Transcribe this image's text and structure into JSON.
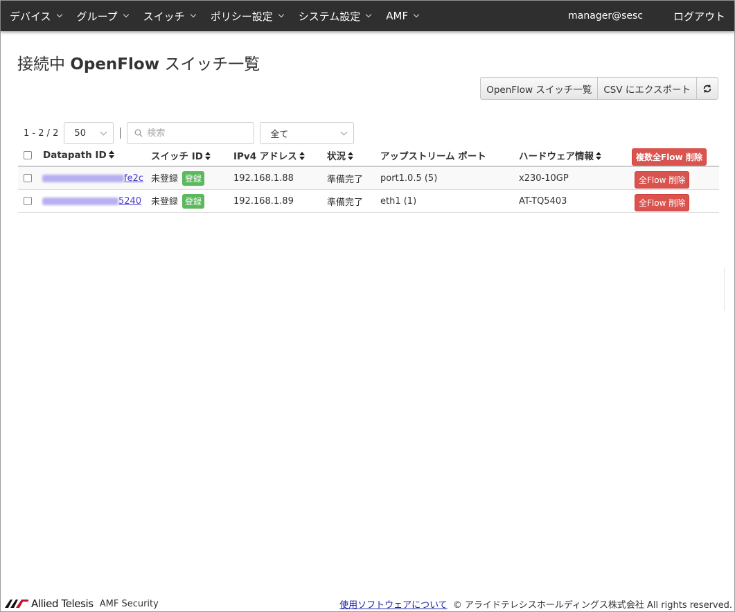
{
  "nav": {
    "items": [
      {
        "label": "デバイス"
      },
      {
        "label": "グループ"
      },
      {
        "label": "スイッチ"
      },
      {
        "label": "ポリシー設定"
      },
      {
        "label": "システム設定"
      },
      {
        "label": "AMF"
      }
    ],
    "user": "manager@sesc",
    "logout": "ログアウト"
  },
  "page": {
    "title_prefix": "接続中 ",
    "title_bold": "OpenFlow",
    "title_suffix": " スイッチ一覧"
  },
  "buttons": {
    "openflow_list": "OpenFlow スイッチ一覧",
    "csv_export": "CSV にエクスポート",
    "refresh_icon": "refresh-icon"
  },
  "toolbar": {
    "pagination": "1 - 2 / 2",
    "page_size": "50",
    "search_placeholder": "検索",
    "filter": "全て"
  },
  "table": {
    "headers": {
      "datapath_id": "Datapath ID",
      "switch_id": "スイッチ ID",
      "ipv4": "IPv4 アドレス",
      "status": "状況",
      "upstream": "アップストリーム ポート",
      "hardware": "ハードウェア情報",
      "bulk_delete": "複数全Flow 削除"
    },
    "rows": [
      {
        "datapath_suffix": "fe2c",
        "switch_id": "未登録",
        "register": "登録",
        "ipv4": "192.168.1.88",
        "status": "準備完了",
        "upstream": "port1.0.5 (5)",
        "hardware": "x230-10GP",
        "delete": "全Flow 削除"
      },
      {
        "datapath_suffix": "5240",
        "switch_id": "未登録",
        "register": "登録",
        "ipv4": "192.168.1.89",
        "status": "準備完了",
        "upstream": "eth1 (1)",
        "hardware": "AT-TQ5403",
        "delete": "全Flow 削除"
      }
    ]
  },
  "footer": {
    "brand": "Allied Telesis",
    "product": "AMF Security",
    "link": "使用ソフトウェアについて",
    "copyright": "© アライドテレシスホールディングス株式会社 All rights reserved."
  },
  "colors": {
    "navbar": "#2f2f2f",
    "success": "#5cb85c",
    "danger": "#d9534f",
    "link": "#4b3bd1"
  }
}
